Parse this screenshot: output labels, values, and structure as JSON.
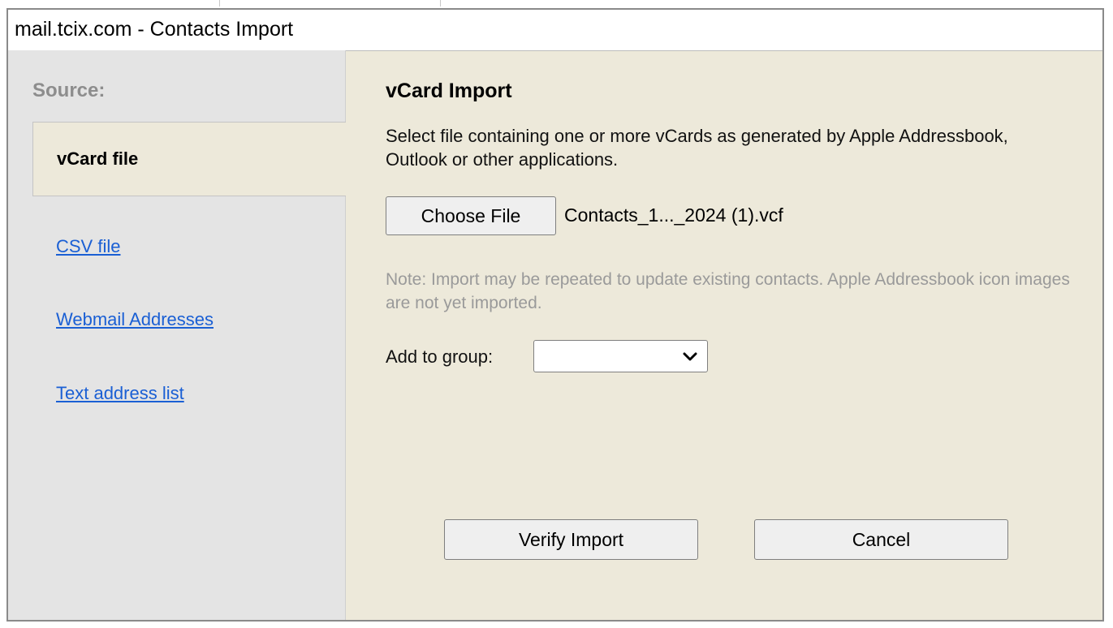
{
  "window": {
    "title": "mail.tcix.com - Contacts Import"
  },
  "sidebar": {
    "source_label": "Source:",
    "items": [
      {
        "label": "vCard file",
        "active": true
      },
      {
        "label": "CSV file",
        "active": false
      },
      {
        "label": "Webmail Addresses",
        "active": false
      },
      {
        "label": "Text address list",
        "active": false
      }
    ]
  },
  "main": {
    "title": "vCard Import",
    "description": "Select file containing one or more vCards as generated by Apple Addressbook, Outlook or other applications.",
    "file": {
      "button_label": "Choose File",
      "selected_name": "Contacts_1..._2024 (1).vcf"
    },
    "note": "Note: Import may be repeated to update existing contacts. Apple Addressbook icon images are not yet imported.",
    "group": {
      "label": "Add to group:",
      "selected": ""
    },
    "actions": {
      "verify_label": "Verify Import",
      "cancel_label": "Cancel"
    }
  },
  "colors": {
    "panel_bg": "#ede9da",
    "sidebar_bg": "#e4e4e4",
    "link": "#1a5fd4",
    "note_text": "#9a9a9a"
  }
}
